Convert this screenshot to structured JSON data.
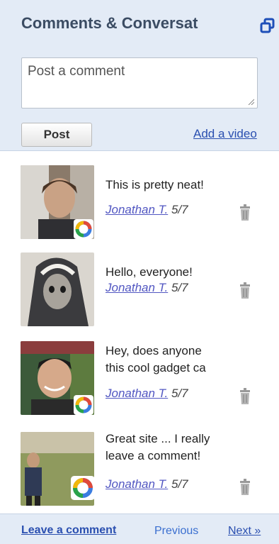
{
  "widget": {
    "title": "Comments & Conversat",
    "comment_placeholder": "Post a comment",
    "post_label": "Post",
    "add_video_label": "Add a video"
  },
  "comments": [
    {
      "lines": [
        "This is pretty neat!"
      ],
      "author": "Jonathan T.",
      "date": "5/7"
    },
    {
      "lines": [
        "Hello, everyone!"
      ],
      "author": "Jonathan T.",
      "date": "5/7"
    },
    {
      "lines": [
        "Hey, does anyone",
        "this cool gadget ca"
      ],
      "author": "Jonathan T.",
      "date": "5/7"
    },
    {
      "lines": [
        "Great site ... I really",
        "leave a comment!"
      ],
      "author": "Jonathan T.",
      "date": "5/7"
    }
  ],
  "footer": {
    "leave_comment": "Leave a comment",
    "previous": "Previous",
    "next": "Next »"
  },
  "colors": {
    "header_bg": "#e3ebf6",
    "link": "#2a4fb0",
    "author_link": "#5257c2"
  }
}
